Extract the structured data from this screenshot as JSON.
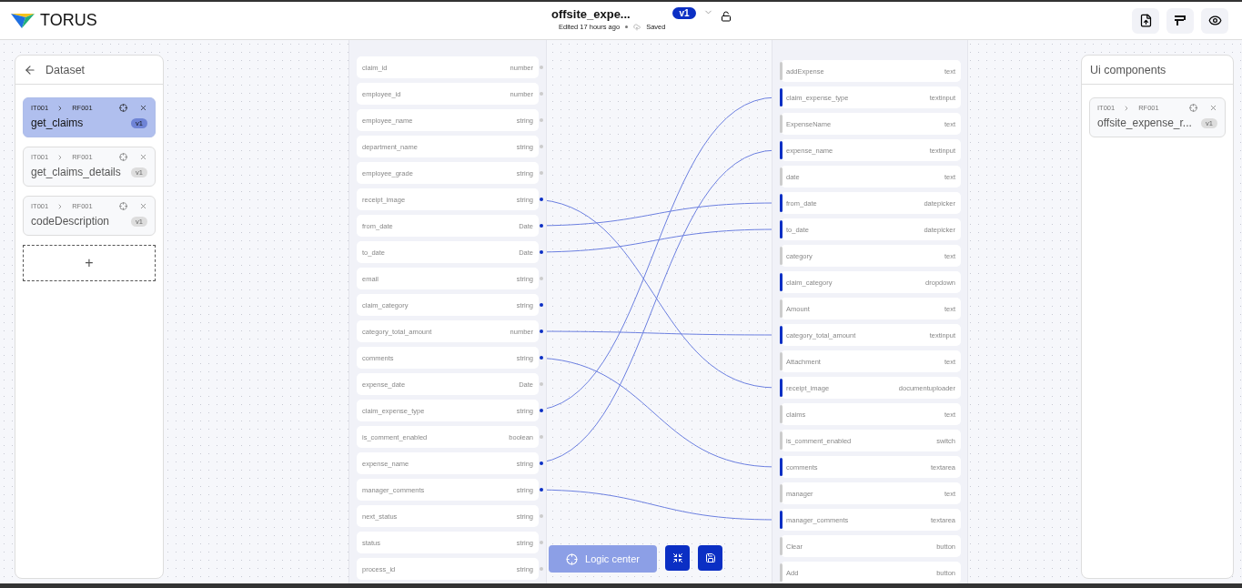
{
  "header": {
    "brand": "TORUS",
    "title": "offsite_expe...",
    "version": "v1",
    "edited": "Edited 17 hours ago",
    "save_status": "Saved"
  },
  "dataset_panel": {
    "title": "Dataset",
    "items": [
      {
        "path_from": "IT001",
        "path_to": "RF001",
        "name": "get_claims",
        "version": "v1",
        "selected": true
      },
      {
        "path_from": "IT001",
        "path_to": "RF001",
        "name": "get_claims_details",
        "version": "v1",
        "selected": false
      },
      {
        "path_from": "IT001",
        "path_to": "RF001",
        "name": "codeDescription",
        "version": "v1",
        "selected": false
      }
    ],
    "add_label": "+"
  },
  "source_node": {
    "fields": [
      {
        "name": "claim_id",
        "type": "number",
        "linked": false
      },
      {
        "name": "employee_id",
        "type": "number",
        "linked": false
      },
      {
        "name": "employee_name",
        "type": "string",
        "linked": false
      },
      {
        "name": "department_name",
        "type": "string",
        "linked": false
      },
      {
        "name": "employee_grade",
        "type": "string",
        "linked": false
      },
      {
        "name": "receipt_image",
        "type": "string",
        "linked": true
      },
      {
        "name": "from_date",
        "type": "Date",
        "linked": true
      },
      {
        "name": "to_date",
        "type": "Date",
        "linked": true
      },
      {
        "name": "email",
        "type": "string",
        "linked": false
      },
      {
        "name": "claim_category",
        "type": "string",
        "linked": true
      },
      {
        "name": "category_total_amount",
        "type": "number",
        "linked": true
      },
      {
        "name": "comments",
        "type": "string",
        "linked": true
      },
      {
        "name": "expense_date",
        "type": "Date",
        "linked": false
      },
      {
        "name": "claim_expense_type",
        "type": "string",
        "linked": true
      },
      {
        "name": "is_comment_enabled",
        "type": "boolean",
        "linked": false
      },
      {
        "name": "expense_name",
        "type": "string",
        "linked": true
      },
      {
        "name": "manager_comments",
        "type": "string",
        "linked": true
      },
      {
        "name": "next_status",
        "type": "string",
        "linked": false
      },
      {
        "name": "status",
        "type": "string",
        "linked": false
      },
      {
        "name": "process_id",
        "type": "string",
        "linked": false
      }
    ]
  },
  "target_node": {
    "fields": [
      {
        "name": "addExpense",
        "type": "text",
        "linked": false
      },
      {
        "name": "claim_expense_type",
        "type": "textinput",
        "linked": true
      },
      {
        "name": "ExpenseName",
        "type": "text",
        "linked": false
      },
      {
        "name": "expense_name",
        "type": "textinput",
        "linked": true
      },
      {
        "name": "date",
        "type": "text",
        "linked": false
      },
      {
        "name": "from_date",
        "type": "datepicker",
        "linked": true
      },
      {
        "name": "to_date",
        "type": "datepicker",
        "linked": true
      },
      {
        "name": "category",
        "type": "text",
        "linked": false
      },
      {
        "name": "claim_category",
        "type": "dropdown",
        "linked": true
      },
      {
        "name": "Amount",
        "type": "text",
        "linked": false
      },
      {
        "name": "category_total_amount",
        "type": "textinput",
        "linked": true
      },
      {
        "name": "Attachment",
        "type": "text",
        "linked": false
      },
      {
        "name": "receipt_image",
        "type": "documentuploader",
        "linked": true
      },
      {
        "name": "claims",
        "type": "text",
        "linked": false
      },
      {
        "name": "is_comment_enabled",
        "type": "switch",
        "linked": false
      },
      {
        "name": "comments",
        "type": "textarea",
        "linked": true
      },
      {
        "name": "manager",
        "type": "text",
        "linked": false
      },
      {
        "name": "manager_comments",
        "type": "textarea",
        "linked": true
      },
      {
        "name": "Clear",
        "type": "button",
        "linked": false
      },
      {
        "name": "Add",
        "type": "button",
        "linked": false
      }
    ]
  },
  "toolbar": {
    "logic_center": "Logic center"
  },
  "ui_panel": {
    "title": "Ui components",
    "items": [
      {
        "path_from": "IT001",
        "path_to": "RF001",
        "name": "offsite_expense_r...",
        "version": "v1",
        "selected": false
      }
    ]
  }
}
